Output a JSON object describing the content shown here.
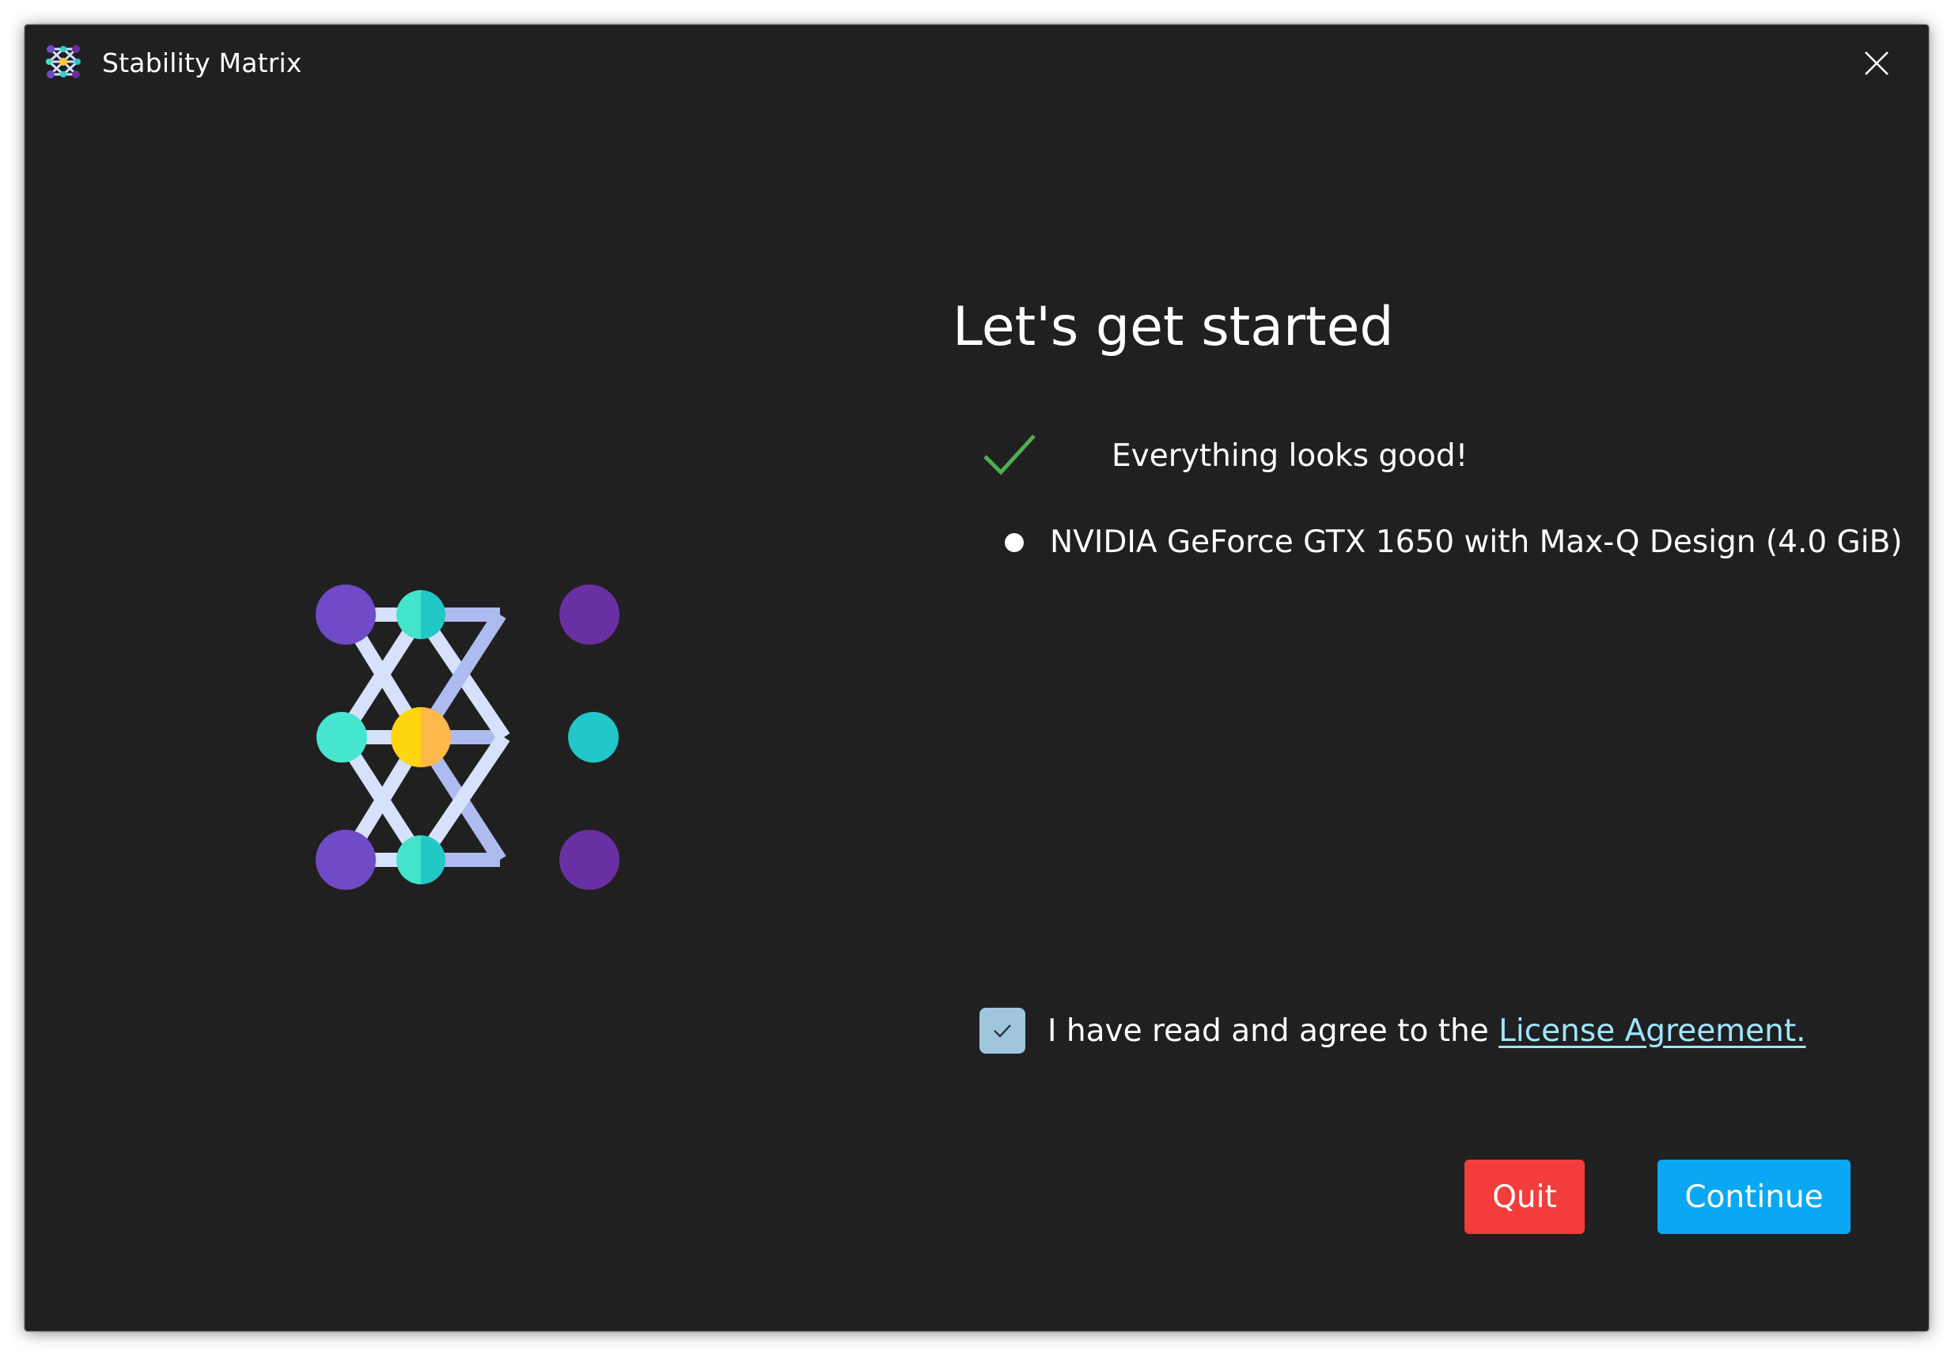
{
  "window": {
    "title": "Stability Matrix",
    "close_icon": "close-icon"
  },
  "main": {
    "heading": "Let's get started",
    "status": {
      "icon": "checkmark-icon",
      "text": "Everything looks good!",
      "color": "#4caf50"
    },
    "gpus": [
      "NVIDIA GeForce GTX 1650 with Max-Q Design (4.0 GiB)"
    ],
    "agreement": {
      "checked": true,
      "text": "I have read and agree to the ",
      "link_label": "License Agreement."
    }
  },
  "buttons": {
    "quit_label": "Quit",
    "continue_label": "Continue"
  },
  "colors": {
    "background": "#202020",
    "quit": "#f33c3c",
    "continue": "#0aa8f2",
    "link": "#9fe6ff",
    "checkbox": "#9fc6dd"
  }
}
